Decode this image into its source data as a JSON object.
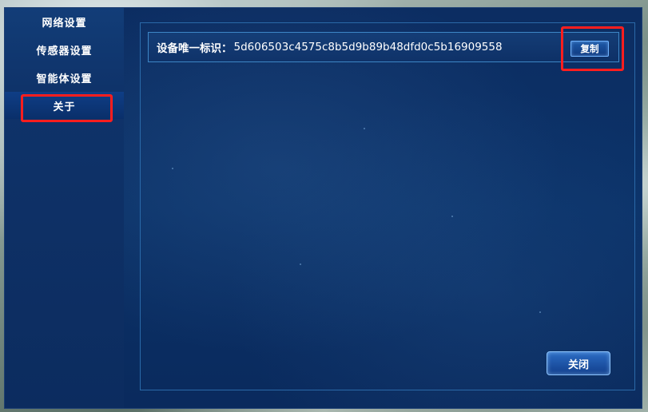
{
  "sidebar": {
    "items": [
      {
        "label": "网络设置"
      },
      {
        "label": "传感器设置"
      },
      {
        "label": "智能体设置"
      },
      {
        "label": "关于"
      }
    ]
  },
  "about": {
    "device_id_label": "设备唯一标识：",
    "device_id_value": "5d606503c4575c8b5d9b89b48dfd0c5b16909558",
    "copy_label": "复制"
  },
  "footer": {
    "close_label": "关闭"
  },
  "colors": {
    "highlight_box": "#ff1e1e",
    "panel_bg": "#0b2a5c",
    "text": "#ffffff"
  }
}
